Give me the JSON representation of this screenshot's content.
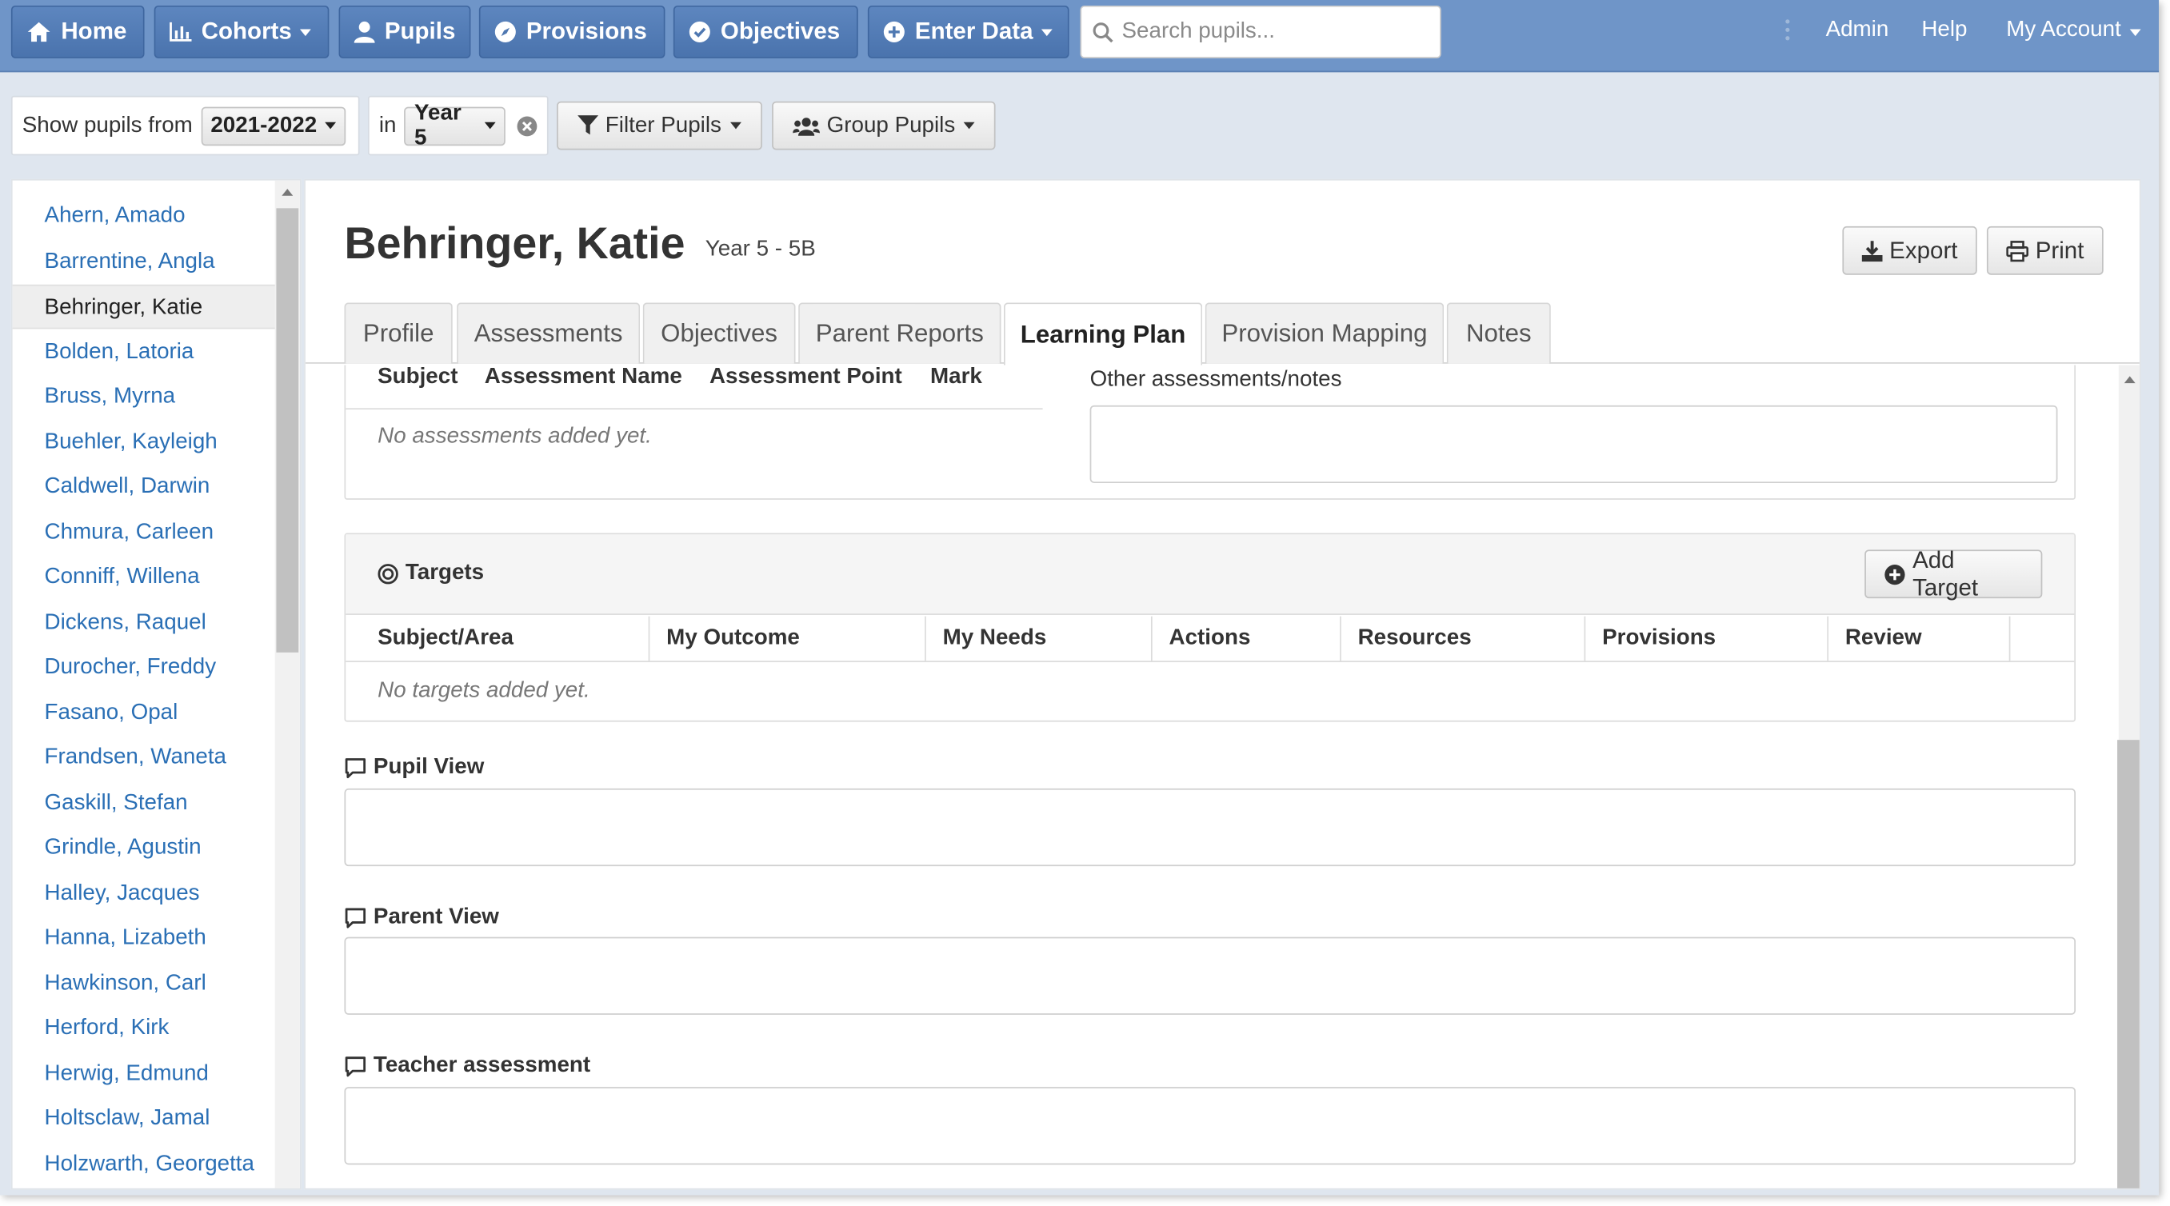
{
  "nav": {
    "home": "Home",
    "cohorts": "Cohorts",
    "pupils": "Pupils",
    "provisions": "Provisions",
    "objectives": "Objectives",
    "enter_data": "Enter Data",
    "search_placeholder": "Search pupils...",
    "admin": "Admin",
    "help": "Help",
    "my_account": "My Account"
  },
  "filters": {
    "show_label": "Show pupils from",
    "year_value": "2021-2022",
    "in_label": "in",
    "group_value": "Year 5",
    "filter_button": "Filter Pupils",
    "group_button": "Group Pupils"
  },
  "pupils": [
    "Ahern, Amado",
    "Barrentine, Angla",
    "Behringer, Katie",
    "Bolden, Latoria",
    "Bruss, Myrna",
    "Buehler, Kayleigh",
    "Caldwell, Darwin",
    "Chmura, Carleen",
    "Conniff, Willena",
    "Dickens, Raquel",
    "Durocher, Freddy",
    "Fasano, Opal",
    "Frandsen, Waneta",
    "Gaskill, Stefan",
    "Grindle, Agustin",
    "Halley, Jacques",
    "Hanna, Lizabeth",
    "Hawkinson, Carl",
    "Herford, Kirk",
    "Herwig, Edmund",
    "Holtsclaw, Jamal",
    "Holzwarth, Georgetta"
  ],
  "active_pupil_index": 2,
  "profile": {
    "name": "Behringer, Katie",
    "class": "Year 5 - 5B",
    "export_button": "Export",
    "print_button": "Print"
  },
  "tabs": [
    "Profile",
    "Assessments",
    "Objectives",
    "Parent Reports",
    "Learning Plan",
    "Provision Mapping",
    "Notes"
  ],
  "active_tab": "Learning Plan",
  "assessments": {
    "headers": [
      "Subject",
      "Assessment Name",
      "Assessment Point",
      "Mark"
    ],
    "empty_text": "No assessments added yet.",
    "notes_label": "Other assessments/notes",
    "notes_value": ""
  },
  "targets": {
    "title": "Targets",
    "add_button": "Add Target",
    "headers": [
      "Subject/Area",
      "My Outcome",
      "My Needs",
      "Actions",
      "Resources",
      "Provisions",
      "Review"
    ],
    "empty_text": "No targets added yet."
  },
  "views": {
    "pupil_view": "Pupil View",
    "parent_view": "Parent View",
    "teacher_assessment": "Teacher assessment"
  }
}
